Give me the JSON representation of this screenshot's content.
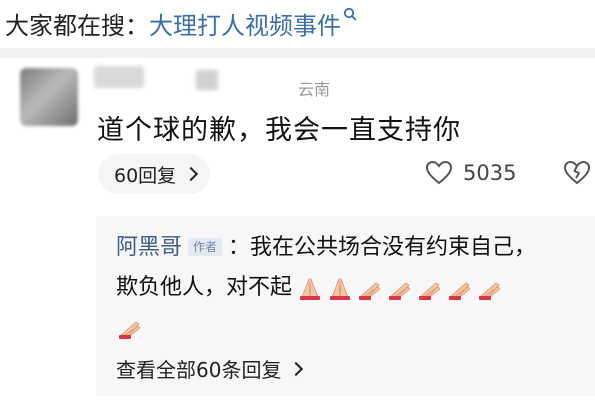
{
  "search": {
    "prefix": "大家都在搜：",
    "query": "大理打人视频事件",
    "icon": "search-icon"
  },
  "comment": {
    "location": "云南",
    "text": "道个球的歉，我会一直支持你",
    "reply_button": "60回复",
    "like_count": "5035",
    "icons": [
      "heart-outline-icon",
      "broken-heart-icon"
    ]
  },
  "author_reply": {
    "name": "阿黑哥",
    "badge": "作者",
    "line1": "：我在公共场合没有约束自己，",
    "line2": "欺负他人，对不起",
    "emoji": "praying-hands-icon",
    "view_all": "查看全部60条回复"
  },
  "colors": {
    "link": "#3a6fa8",
    "author_name": "#3c5e86",
    "panel_bg": "#f7f7f7"
  }
}
